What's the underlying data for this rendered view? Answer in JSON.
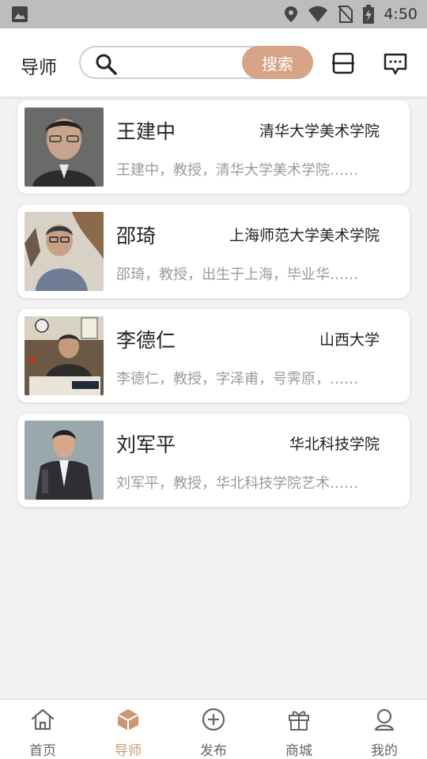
{
  "status_bar": {
    "time": "4:50",
    "icons": [
      "image-icon",
      "location-icon",
      "wifi-icon",
      "no-sim-icon",
      "battery-charging-icon"
    ]
  },
  "header": {
    "title": "导师",
    "search": {
      "placeholder": "",
      "value": "",
      "button_label": "搜索"
    },
    "icons": [
      "scan-icon",
      "message-icon"
    ]
  },
  "tutors": [
    {
      "name": "王建中",
      "school": "清华大学美术学院",
      "description": "王建中，教授，清华大学美术学院……"
    },
    {
      "name": "邵琦",
      "school": "上海师范大学美术学院",
      "description": "邵琦，教授，出生于上海，毕业华……"
    },
    {
      "name": "李德仁",
      "school": "山西大学",
      "description": "李德仁，教授，字泽甫，号霁原，……"
    },
    {
      "name": "刘军平",
      "school": "华北科技学院",
      "description": "刘军平，教授，华北科技学院艺术……"
    }
  ],
  "bottom_nav": {
    "items": [
      {
        "label": "首页",
        "icon": "home-icon"
      },
      {
        "label": "导师",
        "icon": "box-icon"
      },
      {
        "label": "发布",
        "icon": "plus-circle-icon"
      },
      {
        "label": "商城",
        "icon": "gift-icon"
      },
      {
        "label": "我的",
        "icon": "user-icon"
      }
    ],
    "active_index": 1
  },
  "colors": {
    "accent": "#d7a386",
    "active_nav": "#c99775",
    "status_bar": "#bdbdbd",
    "background": "#f2f2f2"
  }
}
